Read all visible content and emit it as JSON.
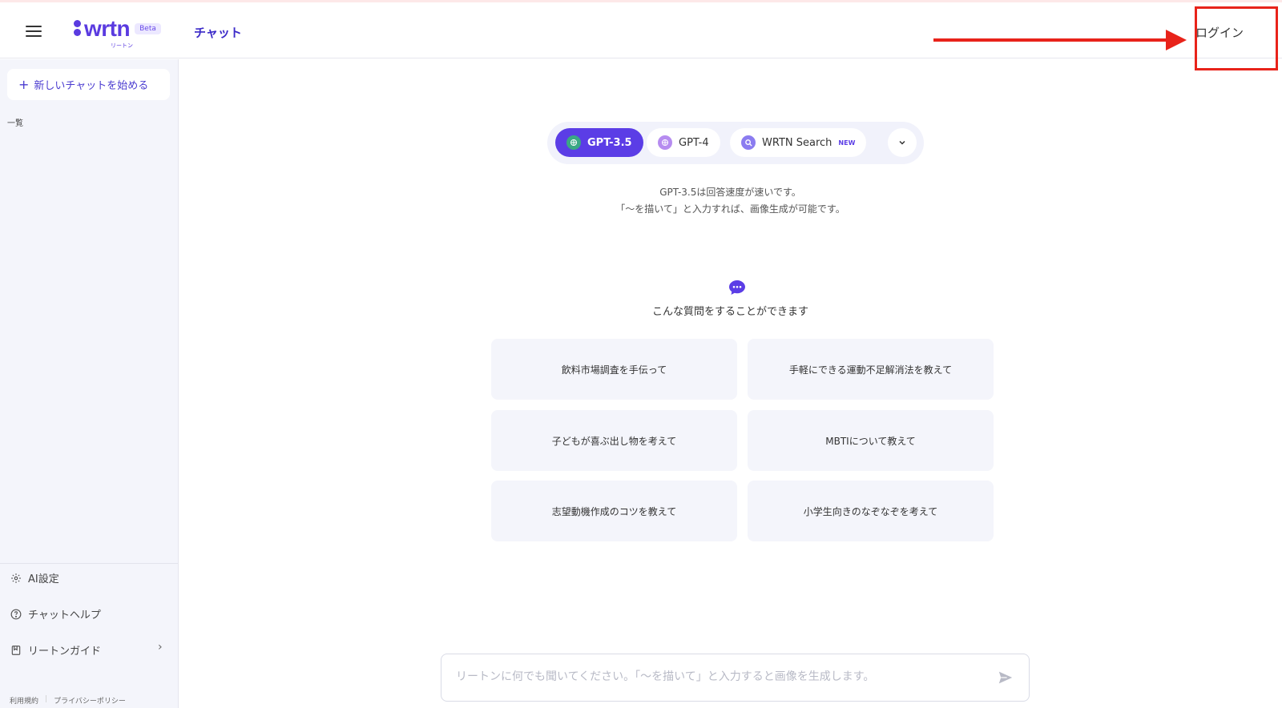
{
  "header": {
    "logo_text": "wrtn",
    "logo_sub": "リートン",
    "beta_label": "Beta",
    "nav_chat": "チャット",
    "login_label": "ログイン"
  },
  "sidebar": {
    "new_chat_label": "新しいチャットを始める",
    "list_label": "一覧",
    "items": [
      {
        "label": "AI設定",
        "icon": "gear-icon"
      },
      {
        "label": "チャットヘルプ",
        "icon": "help-circle-icon"
      },
      {
        "label": "リートンガイド",
        "icon": "book-icon"
      }
    ],
    "footer_links": [
      "利用規約",
      "プライバシーポリシー"
    ]
  },
  "main": {
    "models": [
      {
        "label": "GPT-3.5",
        "active": true
      },
      {
        "label": "GPT-4",
        "active": false
      },
      {
        "label": "WRTN Search",
        "badge": "NEW",
        "active": false
      }
    ],
    "description_line1": "GPT-3.5は回答速度が速いです。",
    "description_line2": "「〜を描いて」と入力すれば、画像生成が可能です。",
    "suggest_title": "こんな質問をすることができます",
    "suggestions": [
      "飲料市場調査を手伝って",
      "手軽にできる運動不足解消法を教えて",
      "子どもが喜ぶ出し物を考えて",
      "MBTIについて教えて",
      "志望動機作成のコツを教えて",
      "小学生向きのなぞなぞを考えて"
    ],
    "input_placeholder": "リートンに何でも聞いてください。「〜を描いて」と入力すると画像を生成します。"
  },
  "colors": {
    "brand": "#5b3de6",
    "annotation_red": "#e8231a",
    "sidebar_bg": "#f4f5fb"
  }
}
